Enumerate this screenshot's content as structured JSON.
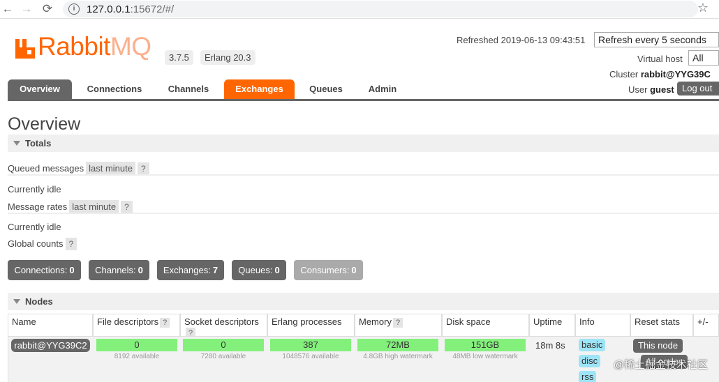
{
  "browser": {
    "url_host": "127.0.0.1",
    "url_rest": ":15672/#/",
    "back_glyph": "←",
    "forward_glyph": "→",
    "reload_glyph": "⟳",
    "info_glyph": "i",
    "star_glyph": "☆"
  },
  "header": {
    "logo_text": "Rabbit",
    "logo_mq": "MQ",
    "version": "3.7.5",
    "erlang": "Erlang 20.3",
    "refreshed": "Refreshed 2019-06-13 09:43:51",
    "refresh_select": "Refresh every 5 seconds",
    "vhost_label": "Virtual host",
    "vhost_select": "All",
    "cluster_label": "Cluster",
    "cluster_value": "rabbit@YYG39C",
    "user_label": "User",
    "user_value": "guest",
    "logout_label": "Log out"
  },
  "tabs": [
    {
      "label": "Overview"
    },
    {
      "label": "Connections"
    },
    {
      "label": "Channels"
    },
    {
      "label": "Exchanges"
    },
    {
      "label": "Queues"
    },
    {
      "label": "Admin"
    }
  ],
  "page_title": "Overview",
  "totals": {
    "header": "Totals",
    "queued_messages_label": "Queued messages",
    "queued_messages_range": "last minute",
    "help": "?",
    "idle_1": "Currently idle",
    "message_rates_label": "Message rates",
    "message_rates_range": "last minute",
    "idle_2": "Currently idle",
    "global_counts_label": "Global counts"
  },
  "counts": [
    {
      "label": "Connections:",
      "value": "0"
    },
    {
      "label": "Channels:",
      "value": "0"
    },
    {
      "label": "Exchanges:",
      "value": "7"
    },
    {
      "label": "Queues:",
      "value": "0"
    },
    {
      "label": "Consumers:",
      "value": "0"
    }
  ],
  "nodes": {
    "header": "Nodes",
    "columns": [
      "Name",
      "File descriptors",
      "Socket descriptors",
      "Erlang processes",
      "Memory",
      "Disk space",
      "Uptime",
      "Info",
      "Reset stats",
      "+/-"
    ],
    "row": {
      "name": "rabbit@YYG39C2",
      "file_descriptors": "0",
      "file_descriptors_sub": "8192 available",
      "socket_descriptors": "0",
      "socket_descriptors_sub": "7280 available",
      "erlang_processes": "387",
      "erlang_processes_sub": "1048576 available",
      "memory": "72MB",
      "memory_sub": "4.8GB high watermark",
      "disk_space": "151GB",
      "disk_space_sub": "48MB low watermark",
      "uptime": "18m 8s",
      "info_tags": [
        "basic",
        "disc",
        "rss"
      ],
      "reset_this": "This node",
      "reset_all": "All nodes"
    }
  },
  "watermark": "@稀土掘金技术社区"
}
